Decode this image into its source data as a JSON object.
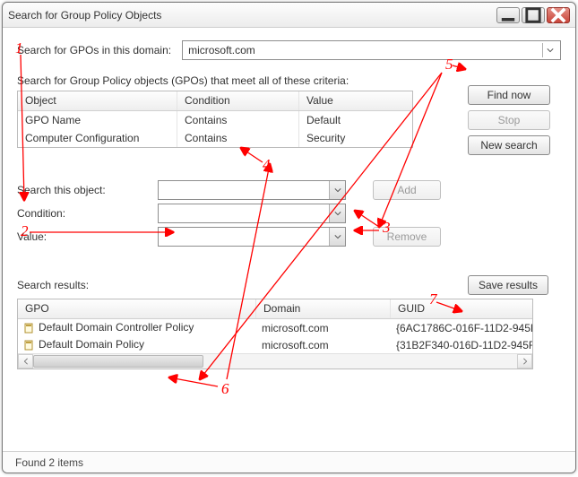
{
  "window": {
    "title": "Search for Group Policy Objects"
  },
  "domain_row": {
    "label": "Search for GPOs in this domain:",
    "value": "microsoft.com"
  },
  "criteria": {
    "intro": "Search for Group Policy objects (GPOs) that meet all of these criteria:",
    "headers": {
      "object": "Object",
      "condition": "Condition",
      "value": "Value"
    },
    "rows": [
      {
        "object": "GPO Name",
        "condition": "Contains",
        "value": "Default"
      },
      {
        "object": "Computer Configuration",
        "condition": "Contains",
        "value": "Security"
      }
    ]
  },
  "side_buttons": {
    "find_now": "Find now",
    "stop": "Stop",
    "new_search": "New search"
  },
  "form": {
    "search_object": {
      "label": "Search this object:",
      "value": ""
    },
    "condition": {
      "label": "Condition:",
      "value": ""
    },
    "value": {
      "label": "Value:",
      "value": ""
    },
    "add": "Add",
    "remove": "Remove"
  },
  "results": {
    "label": "Search results:",
    "save_button": "Save results",
    "headers": {
      "gpo": "GPO",
      "domain": "Domain",
      "guid": "GUID"
    },
    "rows": [
      {
        "gpo": "Default Domain Controller Policy",
        "domain": "microsoft.com",
        "guid": "{6AC1786C-016F-11D2-945F"
      },
      {
        "gpo": "Default Domain Policy",
        "domain": "microsoft.com",
        "guid": "{31B2F340-016D-11D2-945F"
      }
    ]
  },
  "status": "Found 2 items",
  "annotations": [
    "1",
    "2",
    "3",
    "4",
    "5",
    "6",
    "7"
  ]
}
